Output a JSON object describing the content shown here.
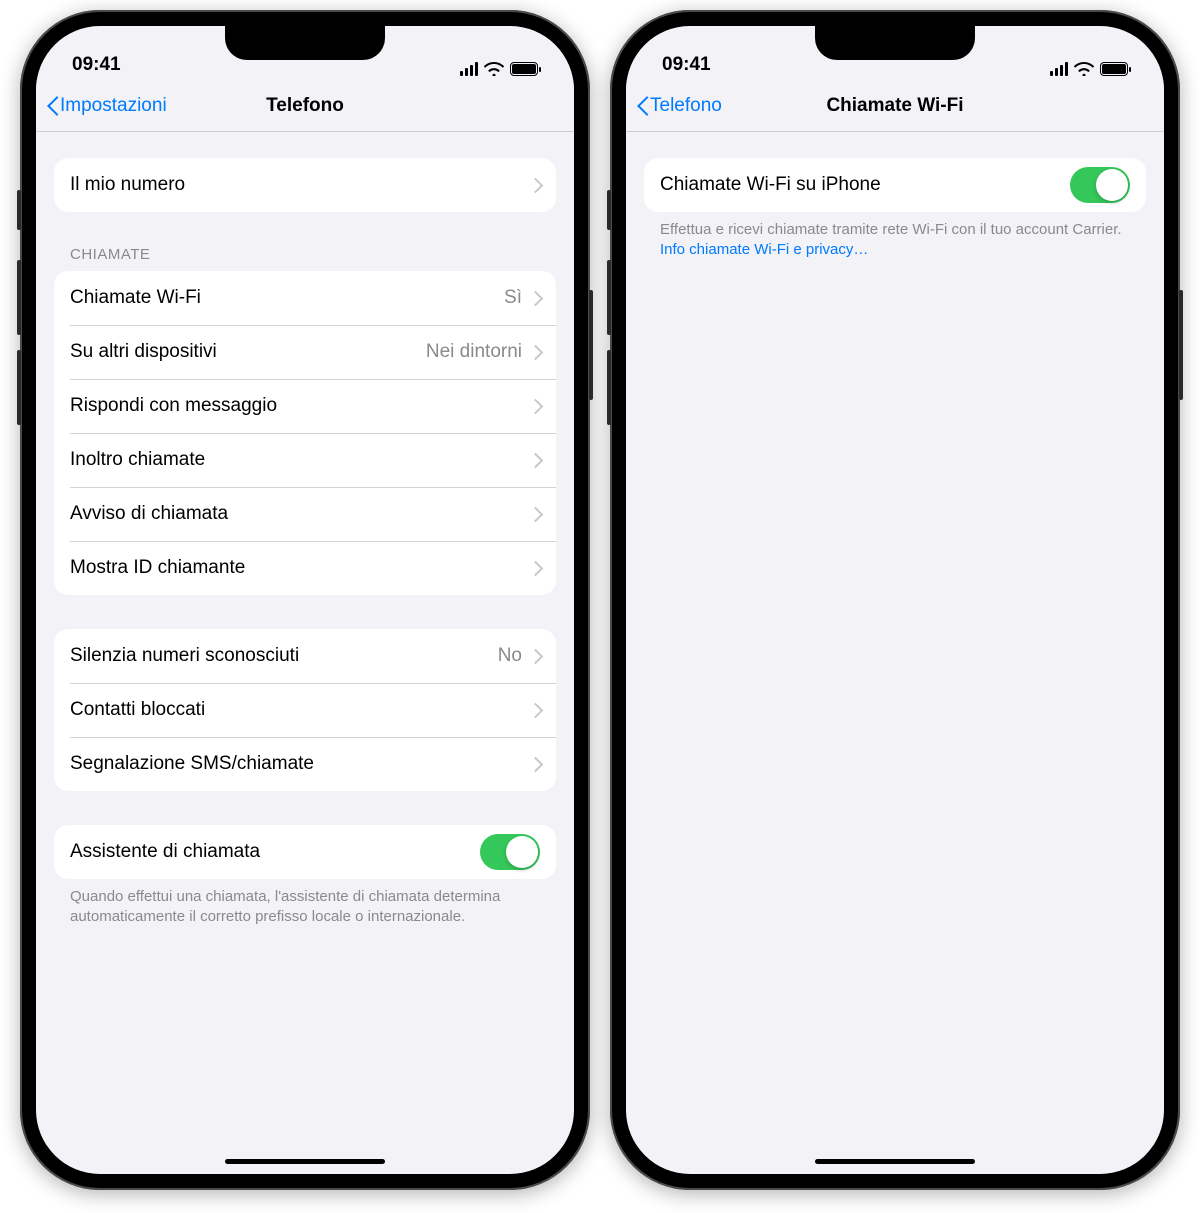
{
  "status": {
    "time": "09:41"
  },
  "left": {
    "back": "Impostazioni",
    "title": "Telefono",
    "my_number": "Il mio numero",
    "section_calls": "CHIAMATE",
    "calls": [
      {
        "label": "Chiamate Wi-Fi",
        "value": "Sì"
      },
      {
        "label": "Su altri dispositivi",
        "value": "Nei dintorni"
      },
      {
        "label": "Rispondi con messaggio",
        "value": ""
      },
      {
        "label": "Inoltro chiamate",
        "value": ""
      },
      {
        "label": "Avviso di chiamata",
        "value": ""
      },
      {
        "label": "Mostra ID chiamante",
        "value": ""
      }
    ],
    "misc": [
      {
        "label": "Silenzia numeri sconosciuti",
        "value": "No"
      },
      {
        "label": "Contatti bloccati",
        "value": ""
      },
      {
        "label": "Segnalazione SMS/chiamate",
        "value": ""
      }
    ],
    "dial_assist_label": "Assistente di chiamata",
    "dial_assist_footer": "Quando effettui una chiamata, l'assistente di chiamata determina automaticamente il corretto prefisso locale o internazionale."
  },
  "right": {
    "back": "Telefono",
    "title": "Chiamate Wi-Fi",
    "toggle_label": "Chiamate Wi-Fi su iPhone",
    "footer_text": "Effettua e ricevi chiamate tramite rete Wi-Fi con il tuo account Carrier. ",
    "footer_link": "Info chiamate Wi-Fi e privacy…"
  }
}
